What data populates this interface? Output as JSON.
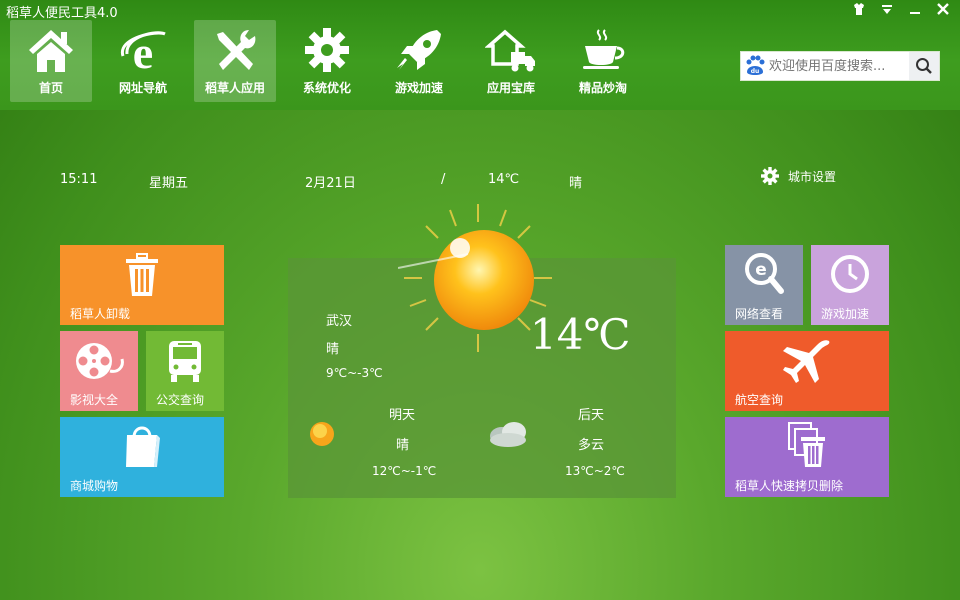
{
  "window": {
    "title": "稻草人便民工具4.0",
    "controls": [
      "skin-icon",
      "menu-icon",
      "minimize-icon",
      "close-icon"
    ]
  },
  "nav": [
    {
      "label": "首页",
      "icon": "home-icon",
      "active": true
    },
    {
      "label": "网址导航",
      "icon": "ie-icon",
      "active": false
    },
    {
      "label": "稻草人应用",
      "icon": "tools-icon",
      "active": true
    },
    {
      "label": "系统优化",
      "icon": "gear-icon",
      "active": false
    },
    {
      "label": "游戏加速",
      "icon": "rocket-icon",
      "active": false
    },
    {
      "label": "应用宝库",
      "icon": "truck-house-icon",
      "active": false
    },
    {
      "label": "精品炒淘",
      "icon": "coffee-cup-icon",
      "active": false
    }
  ],
  "search": {
    "placeholder": "欢迎使用百度搜索...",
    "logo": "baidu-paw-icon",
    "button_icon": "search-icon"
  },
  "info": {
    "time": "15:11",
    "weekday": "星期五",
    "date": "2月21日",
    "separator": "/",
    "temp": "14℃",
    "condition": "晴",
    "city_settings": "城市设置"
  },
  "tiles_left": [
    {
      "label": "稻草人卸载",
      "icon": "trash-icon",
      "color": "#f7922a"
    },
    {
      "label": "影视大全",
      "icon": "film-reel-icon",
      "color": "#ef8b8f"
    },
    {
      "label": "公交查询",
      "icon": "bus-icon",
      "color": "#72ba35"
    },
    {
      "label": "商城购物",
      "icon": "shopping-bag-icon",
      "color": "#2fb1dd"
    }
  ],
  "tiles_right": [
    {
      "label": "网络查看",
      "icon": "magnifier-ie-icon",
      "color": "#8693a6"
    },
    {
      "label": "游戏加速",
      "icon": "clock-icon",
      "color": "#c9a3dc"
    },
    {
      "label": "航空查询",
      "icon": "airplane-icon",
      "color": "#ef5b2b"
    },
    {
      "label": "稻草人快速拷贝删除",
      "icon": "copy-delete-icon",
      "color": "#9e6ccf"
    }
  ],
  "weather": {
    "city": "武汉",
    "condition": "晴",
    "range": "9℃~-3℃",
    "current_temp": "14℃",
    "tomorrow": {
      "label": "明天",
      "condition": "晴",
      "range": "12℃~-1℃",
      "icon": "sun-icon"
    },
    "after": {
      "label": "后天",
      "condition": "多云",
      "range": "13℃~2℃",
      "icon": "cloud-icon"
    }
  }
}
